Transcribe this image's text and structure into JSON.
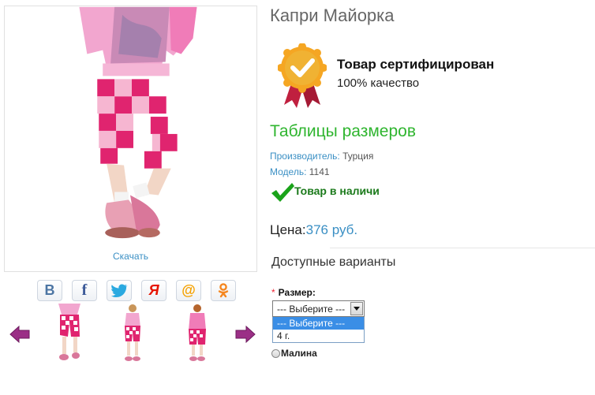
{
  "product": {
    "title": "Капри Майорка",
    "download_label": "Скачать"
  },
  "share": {
    "buttons": [
      {
        "icon": "vk-icon",
        "glyph": "B",
        "color": "#4c75a3"
      },
      {
        "icon": "facebook-icon",
        "glyph": "f",
        "color": "#3b5998"
      },
      {
        "icon": "twitter-icon",
        "glyph": "",
        "color": "#2aa9e0"
      },
      {
        "icon": "yandex-icon",
        "glyph": "Я",
        "color": "#e61400"
      },
      {
        "icon": "mailru-icon",
        "glyph": "@",
        "color": "#f5a100"
      },
      {
        "icon": "odnoklassniki-icon",
        "glyph": "ok",
        "color": "#f5861f"
      }
    ]
  },
  "certificate": {
    "title": "Товар сертифицирован",
    "subtitle": "100% качество"
  },
  "size_table_link": "Таблицы размеров",
  "specs": {
    "maker_label": "Производитель:",
    "maker_value": "Турция",
    "model_label": "Модель:",
    "model_value": "1141"
  },
  "stock_text": "Товар в наличи",
  "price": {
    "label": "Цена:",
    "value": "376 руб."
  },
  "variants": {
    "heading": "Доступные варианты",
    "size_required_mark": "*",
    "size_label": "Размер:",
    "selected": "--- Выберите ---",
    "options": [
      "--- Выберите ---",
      "4 г."
    ],
    "color_option": "Малина"
  },
  "colors": {
    "accent_green": "#2fb52f",
    "link_blue": "#3a8fc4",
    "stock_green": "#1b7a1b",
    "dropdown_highlight": "#3a8ee6"
  }
}
